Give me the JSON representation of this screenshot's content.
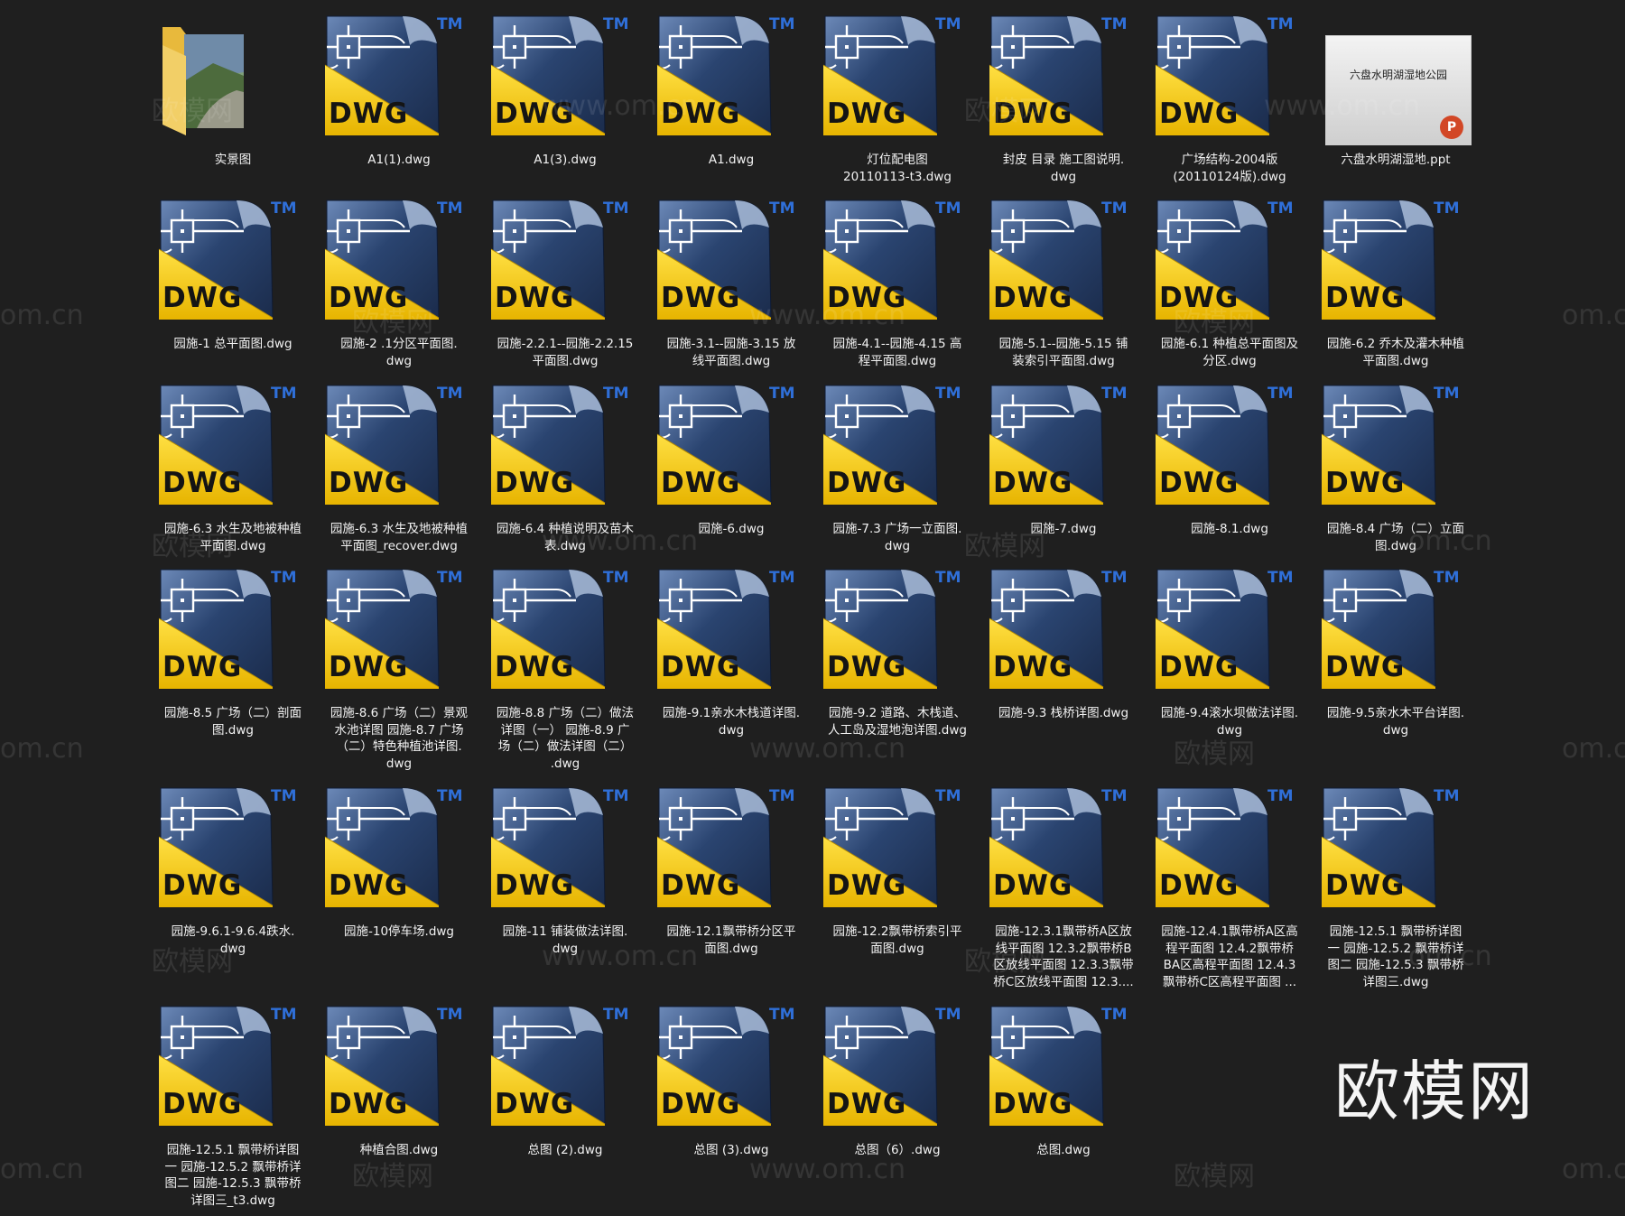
{
  "window": {
    "background": "#1f1f1f"
  },
  "icons": {
    "dwg": {
      "badge": "DWG",
      "tm": "TM",
      "yellow": "#f5c800",
      "blue": "#2a4470"
    }
  },
  "folder": {
    "name": "实景图"
  },
  "ppt": {
    "name": "六盘水明湖湿地.ppt",
    "slide_title": "六盘水明湖湿地公园",
    "badge": "P"
  },
  "files": [
    "A1(1).dwg",
    "A1(3).dwg",
    "A1.dwg",
    "灯位配电图\n20110113-t3.dwg",
    "封皮 目录 施工图说明.\ndwg",
    "广场结构-2004版\n(20110124版).dwg",
    "园施-1 总平面图.dwg",
    "园施-2 .1分区平面图.\ndwg",
    "园施-2.2.1--园施-2.2.15\n平面图.dwg",
    "园施-3.1--园施-3.15 放\n线平面图.dwg",
    "园施-4.1--园施-4.15 高\n程平面图.dwg",
    "园施-5.1--园施-5.15 铺\n装索引平面图.dwg",
    "园施-6.1 种植总平面图及\n分区.dwg",
    "园施-6.2 乔木及灌木种植\n平面图.dwg",
    "园施-6.3 水生及地被种植\n平面图.dwg",
    "园施-6.3 水生及地被种植\n平面图_recover.dwg",
    "园施-6.4 种植说明及苗木\n表.dwg",
    "园施-6.dwg",
    "园施-7.3 广场一立面图.\ndwg",
    "园施-7.dwg",
    "园施-8.1.dwg",
    "园施-8.4 广场（二）立面\n图.dwg",
    "园施-8.5 广场（二）剖面\n图.dwg",
    "园施-8.6 广场（二）景观\n水池详图 园施-8.7 广场\n（二）特色种植池详图.\ndwg",
    "园施-8.8 广场（二）做法\n详图（一） 园施-8.9 广\n场（二）做法详图（二）\n.dwg",
    "园施-9.1亲水木栈道详图.\ndwg",
    "园施-9.2 道路、木栈道、\n人工岛及湿地泡详图.dwg",
    "园施-9.3 栈桥详图.dwg",
    "园施-9.4滚水坝做法详图.\ndwg",
    "园施-9.5亲水木平台详图.\ndwg",
    "园施-9.6.1-9.6.4跌水.\ndwg",
    "园施-10停车场.dwg",
    "园施-11 铺装做法详图.\ndwg",
    "园施-12.1飘带桥分区平\n面图.dwg",
    "园施-12.2飘带桥索引平\n面图.dwg",
    "园施-12.3.1飘带桥A区放\n线平面图 12.3.2飘带桥B\n区放线平面图 12.3.3飘带\n桥C区放线平面图 12.3....",
    "园施-12.4.1飘带桥A区高\n程平面图 12.4.2飘带桥\nBA区高程平面图 12.4.3\n飘带桥C区高程平面图 ...",
    "园施-12.5.1 飘带桥详图\n一 园施-12.5.2 飘带桥详\n图二 园施-12.5.3 飘带桥\n详图三.dwg",
    "园施-12.5.1 飘带桥详图\n一 园施-12.5.2 飘带桥详\n图二 园施-12.5.3 飘带桥\n详图三_t3.dwg",
    "种植合图.dwg",
    "总图 (2).dwg",
    "总图 (3).dwg",
    "总图（6）.dwg",
    "总图.dwg"
  ],
  "watermark": {
    "logo": "欧模网",
    "url": "www.om.cn",
    "url_short": "om.cn"
  },
  "brand": "欧模网"
}
